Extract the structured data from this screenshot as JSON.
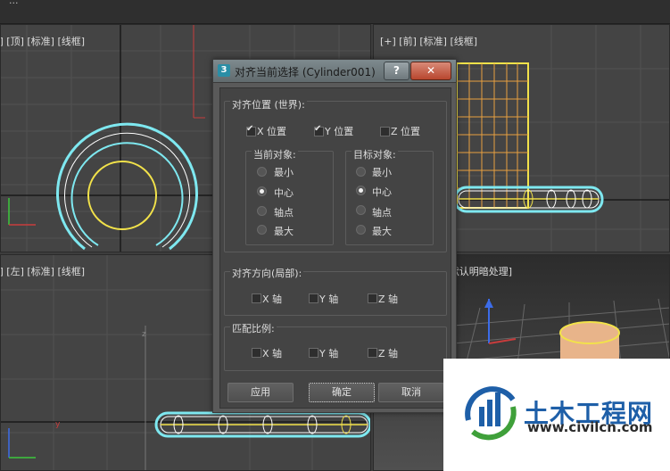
{
  "viewports": {
    "top": {
      "label": "[+] [顶] [标准] [线框]"
    },
    "front": {
      "label": "[+] [前] [标准] [线框]"
    },
    "left": {
      "label": "[+] [左] [标准] [线框]"
    },
    "perspective": {
      "label": "[+] [透视] [标准] [默认明暗处理]"
    }
  },
  "axis_labels": {
    "x": "x",
    "y": "y",
    "z": "z"
  },
  "dialog": {
    "app_icon": "3",
    "title": "对齐当前选择 (Cylinder001)",
    "help_label": "?",
    "close_label": "✕",
    "align_position": {
      "title": "对齐位置 (世界):",
      "x": {
        "label": "X 位置",
        "checked": true
      },
      "y": {
        "label": "Y 位置",
        "checked": true
      },
      "z": {
        "label": "Z 位置",
        "checked": false
      },
      "current_object": {
        "title": "当前对象:",
        "options": [
          "最小",
          "中心",
          "轴点",
          "最大"
        ],
        "selected": "中心"
      },
      "target_object": {
        "title": "目标对象:",
        "options": [
          "最小",
          "中心",
          "轴点",
          "最大"
        ],
        "selected": "中心"
      }
    },
    "align_orientation": {
      "title": "对齐方向(局部):",
      "x": "X 轴",
      "y": "Y 轴",
      "z": "Z 轴"
    },
    "match_scale": {
      "title": "匹配比例:",
      "x": "X 轴",
      "y": "Y 轴",
      "z": "Z 轴"
    },
    "buttons": {
      "apply": "应用",
      "ok": "确定",
      "cancel": "取消"
    }
  },
  "watermark": {
    "name": "土木工程网",
    "url": "www.civilcn.com"
  },
  "colors": {
    "selected_object": "#7ee8f0",
    "target_object": "#f2e24a",
    "grid": "#5a5a5a",
    "axis_red": "#c83c3c",
    "axis_green": "#3cc83c",
    "axis_blue": "#3c6ce8"
  }
}
